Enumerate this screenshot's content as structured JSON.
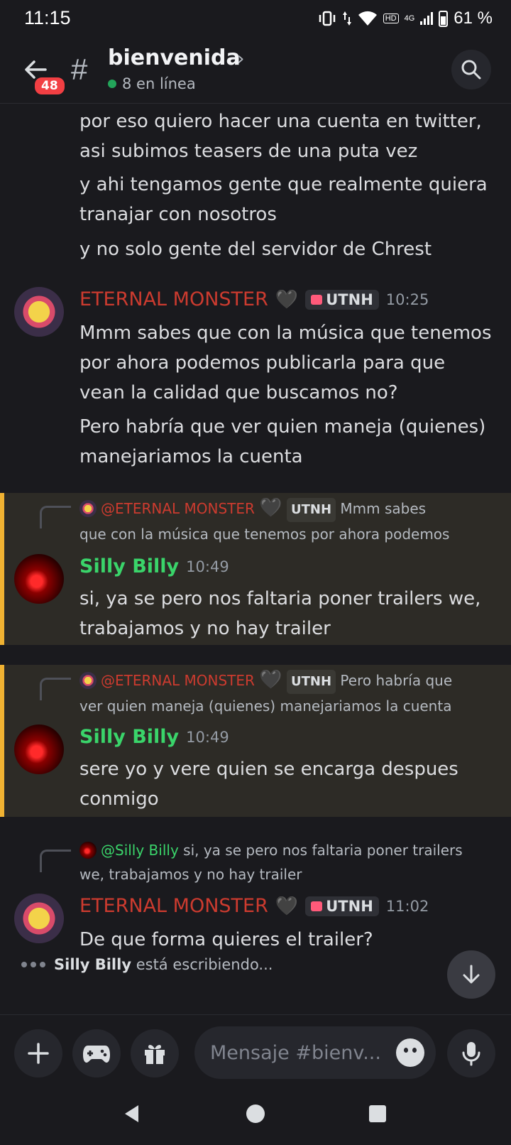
{
  "status_bar": {
    "time": "11:15",
    "hd": "HD",
    "network": "4G",
    "battery": "61 %"
  },
  "header": {
    "unread_count": "48",
    "channel_name": "bienvenida",
    "online_text": "8 en línea"
  },
  "messages_top": [
    "por eso quiero hacer una cuenta en twitter,",
    "asi subimos teasers de una puta vez",
    "y ahi tengamos gente que realmente quiera",
    "tranajar con nosotros",
    "y no solo gente del servidor de Chrest"
  ],
  "msg1": {
    "author": "ETERNAL MONSTER",
    "heart": "🖤",
    "tag": "UTNH",
    "time": "10:25",
    "lines": [
      "Mmm sabes que con la música que tenemos",
      "por ahora podemos publicarla para que",
      "vean la calidad que buscamos no?",
      "Pero habría que ver quien maneja (quienes)",
      "manejariamos la cuenta"
    ]
  },
  "msg2": {
    "reply_author": "@ETERNAL MONSTER",
    "reply_heart": "🖤",
    "reply_tag": "UTNH",
    "reply_text_1": "Mmm sabes",
    "reply_text_2": "que con la música que tenemos por ahora podemos",
    "author": "Silly Billy",
    "time": "10:49",
    "lines": [
      "si, ya se pero nos faltaria poner trailers we,",
      "trabajamos y no hay trailer"
    ]
  },
  "msg3": {
    "reply_author": "@ETERNAL MONSTER",
    "reply_heart": "🖤",
    "reply_tag": "UTNH",
    "reply_text_1": "Pero habría que",
    "reply_text_2": "ver quien maneja (quienes) manejariamos la cuenta",
    "author": "Silly Billy",
    "time": "10:49",
    "lines": [
      "sere yo y vere quien se encarga despues",
      "conmigo"
    ]
  },
  "msg4": {
    "reply_author": "@Silly Billy",
    "reply_text_1": "si, ya se pero nos faltaria poner trailers",
    "reply_text_2": "we, trabajamos y no hay trailer",
    "author": "ETERNAL MONSTER",
    "heart": "🖤",
    "tag": "UTNH",
    "time": "11:02",
    "lines": [
      "De que forma quieres el trailer?"
    ]
  },
  "typing": {
    "user": "Silly Billy",
    "text": "está escribiendo..."
  },
  "input": {
    "placeholder": "Mensaje #bienv..."
  },
  "colors": {
    "accent_name": "#cc3b2f",
    "green_name": "#3ad46a",
    "highlight_border": "#f0b232",
    "background": "#1a1a1e"
  }
}
